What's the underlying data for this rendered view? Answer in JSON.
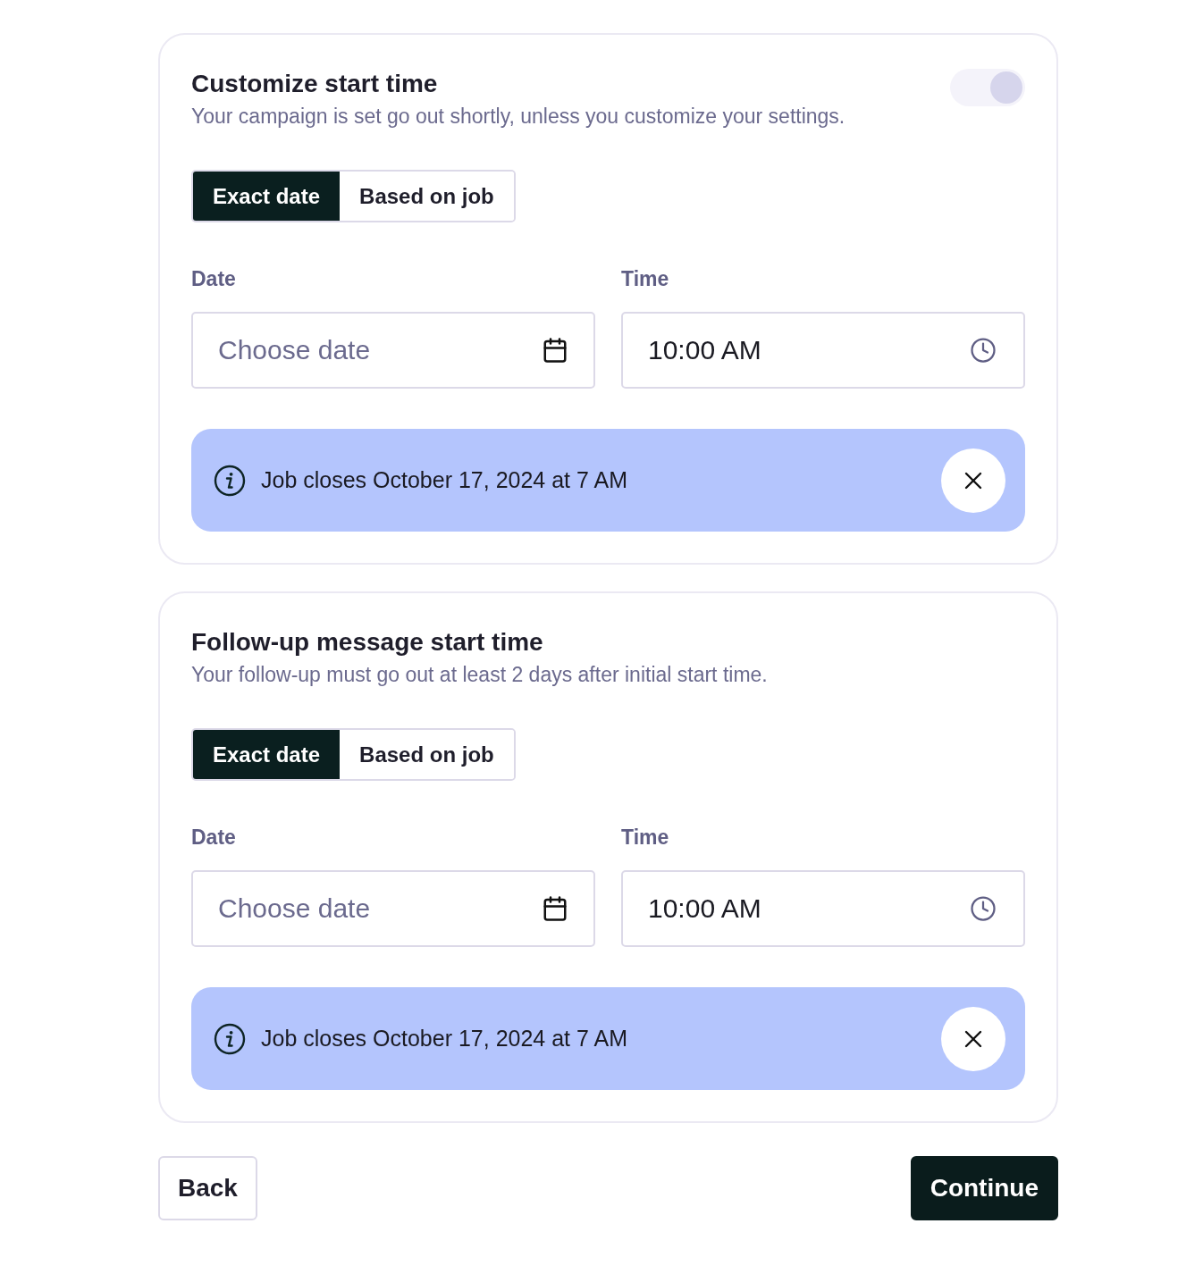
{
  "cards": [
    {
      "title": "Customize start time",
      "description": "Your campaign is set go out shortly, unless you customize your settings.",
      "toggle": {
        "on": true,
        "disabled": true
      },
      "tabs": [
        {
          "label": "Exact date",
          "selected": true
        },
        {
          "label": "Based on job",
          "selected": false
        }
      ],
      "date": {
        "label": "Date",
        "placeholder": "Choose date"
      },
      "time": {
        "label": "Time",
        "value": "10:00 AM"
      },
      "notice": {
        "text": "Job closes October 17, 2024 at 7 AM"
      }
    },
    {
      "title": "Follow-up message start time",
      "description": "Your follow-up must go out at least 2 days after initial start time.",
      "tabs": [
        {
          "label": "Exact date",
          "selected": true
        },
        {
          "label": "Based on job",
          "selected": false
        }
      ],
      "date": {
        "label": "Date",
        "placeholder": "Choose date"
      },
      "time": {
        "label": "Time",
        "value": "10:00 AM"
      },
      "notice": {
        "text": "Job closes October 17, 2024 at 7 AM"
      }
    }
  ],
  "buttons": [
    {
      "label": "Back",
      "kind": "secondary"
    },
    {
      "label": "Continue",
      "kind": "primary"
    }
  ]
}
